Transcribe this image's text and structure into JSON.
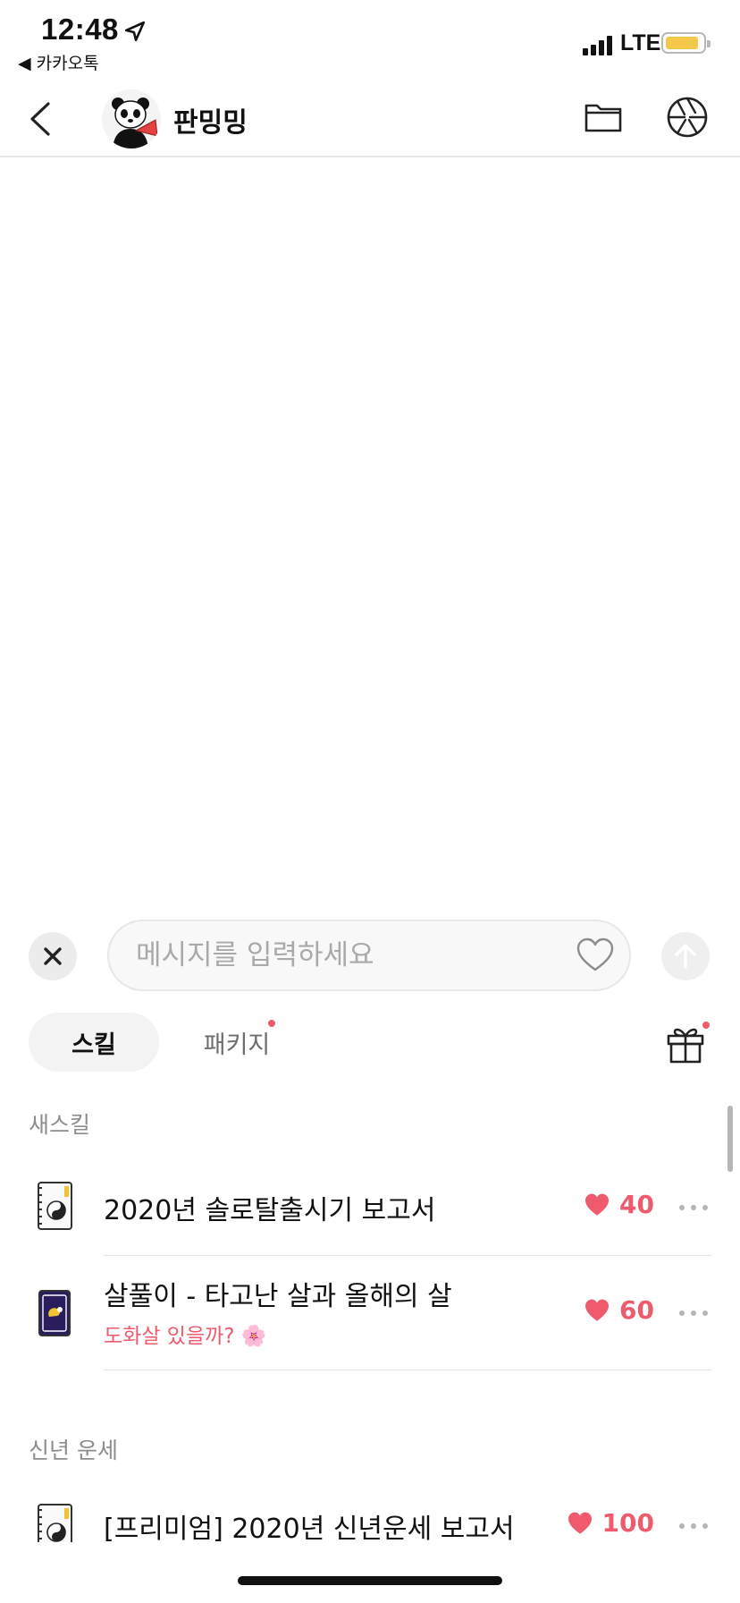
{
  "status_bar": {
    "time": "12:48",
    "back_app": "◀ 카카오톡",
    "network": "LTE",
    "battery_color": "#f4c94a"
  },
  "header": {
    "title": "판밍밍"
  },
  "composer": {
    "placeholder": "메시지를 입력하세요"
  },
  "tabs": {
    "skill": "스킬",
    "package": "패키지"
  },
  "sections": [
    {
      "label": "새스킬",
      "items": [
        {
          "name": "2020년 솔로탈출시기 보고서",
          "subtitle": "",
          "price": "40",
          "icon": "yin-yang-notebook-icon"
        },
        {
          "name": "살풀이 - 타고난 살과 올해의 살",
          "subtitle": "도화살 있을까? 🌸",
          "price": "60",
          "icon": "dark-tarot-card-icon"
        }
      ]
    },
    {
      "label": "신년 운세",
      "items": [
        {
          "name": "[프리미엄] 2020년 신년운세 보고서",
          "subtitle": "",
          "price": "100",
          "icon": "yin-yang-notebook-icon"
        }
      ]
    }
  ],
  "colors": {
    "accent_pink": "#ef5b6c",
    "divider": "#e6e6e6"
  }
}
